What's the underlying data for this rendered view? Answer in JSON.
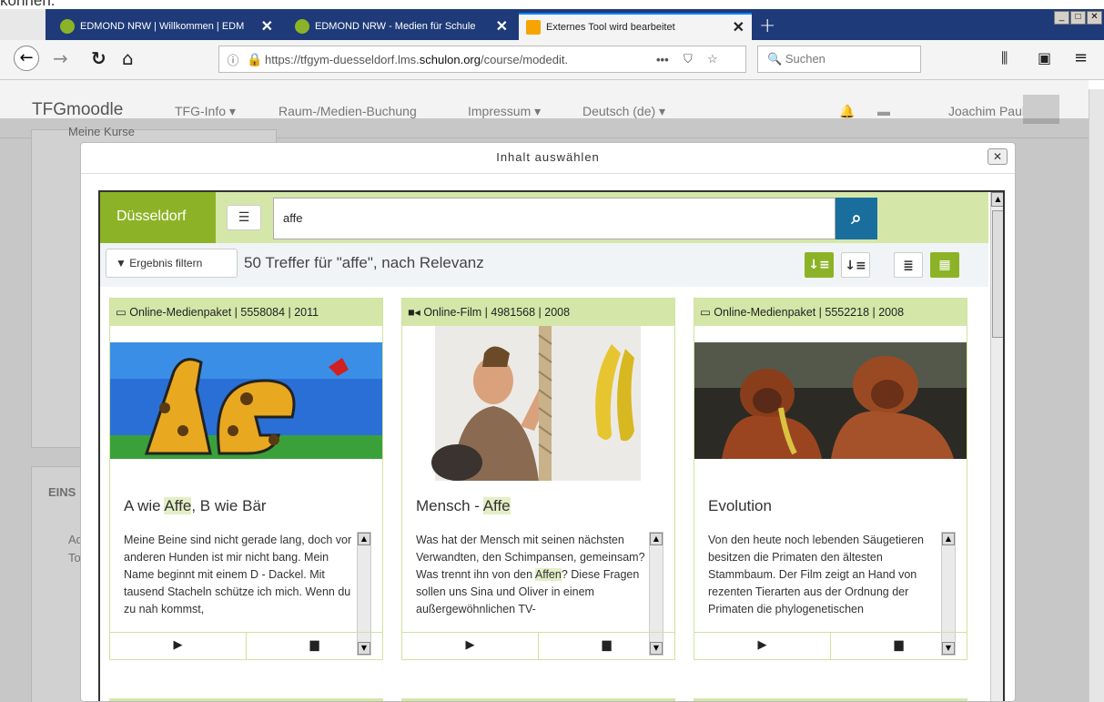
{
  "top_clipped_text": "können.",
  "browser": {
    "tabs": [
      {
        "label": "EDMOND NRW | Willkommen | EDM",
        "close": "✕"
      },
      {
        "label": "EDMOND NRW - Medien für Schule",
        "close": "✕"
      },
      {
        "label": "Externes Tool wird bearbeitet",
        "close": "✕"
      }
    ],
    "new_tab": "+",
    "window_buttons": [
      "_",
      "□",
      "✕"
    ],
    "url": {
      "prefix": "https://tfgym-duesseldorf.lms.",
      "domain": "schulon.org",
      "path": "/course/modedit."
    },
    "more": "•••",
    "search_placeholder": "Suchen"
  },
  "moodle": {
    "brand": "TFGmoodle",
    "nav": [
      "TFG-Info ▾",
      "Raum-/Medien-Buchung",
      "Impressum ▾",
      "Deutsch (de) ▾"
    ],
    "user": "Joachim Paul",
    "bg": {
      "meine_kurse": "Meine Kurse",
      "eins": "EINS",
      "ad": "Ad",
      "to": "To"
    }
  },
  "modal": {
    "title": "Inhalt auswählen",
    "close": "✕",
    "region": "Düsseldorf",
    "search_value": "affe",
    "filter_label": "Ergebnis filtern",
    "result_count": "50 Treffer für \"affe\", nach Relevanz",
    "cards": [
      {
        "head": "Online-Medienpaket | 5558084 | 2011",
        "head_icon": "monitor-icon",
        "title_pre": "A wie ",
        "title_hl": "Affe",
        "title_post": ", B wie Bär",
        "desc": "Meine Beine sind nicht gerade lang, doch vor anderen Hunden ist mir nicht bang. Mein Name beginnt mit einem D - Dackel. Mit tausend Stacheln schütze ich mich. Wenn du zu nah kommst,"
      },
      {
        "head": "Online-Film | 4981568 | 2008",
        "head_icon": "video-camera-icon",
        "title_pre": "Mensch - ",
        "title_hl": "Affe",
        "title_post": "",
        "desc_pre": "Was hat der Mensch mit seinen nächsten Verwandten, den Schimpansen, gemeinsam? Was trennt ihn von den ",
        "desc_hl": "Affen",
        "desc_post": "? Diese Fragen sollen uns Sina und Oliver in einem außergewöhnlichen TV-"
      },
      {
        "head": "Online-Medienpaket | 5552218 | 2008",
        "head_icon": "monitor-icon",
        "title_pre": "Evolution",
        "title_hl": "",
        "title_post": "",
        "desc": "Von den heute noch lebenden Säugetieren besitzen die Primaten den ältesten Stammbaum. Der Film zeigt an Hand von rezenten Tierarten aus der Ordnung der Primaten die phylogenetischen"
      }
    ],
    "play_icon": "▶",
    "doc_icon": "▆"
  },
  "colors": {
    "green": "#8cb327",
    "light_green": "#d4e7a9",
    "blue": "#1a6e9e",
    "tabbar": "#1e3a78"
  }
}
